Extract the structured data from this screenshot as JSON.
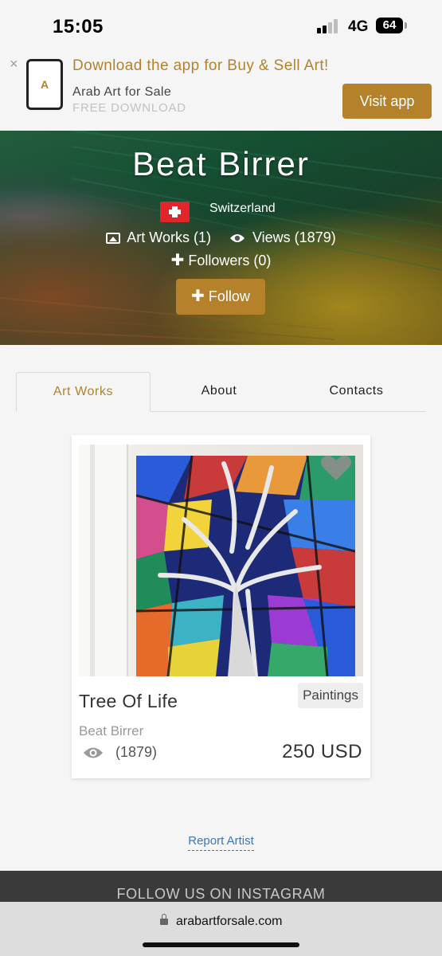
{
  "status_bar": {
    "time": "15:05",
    "network": "4G",
    "battery": "64"
  },
  "app_banner": {
    "close": "×",
    "title": "Download the app for Buy & Sell Art!",
    "app_name": "Arab Art for Sale",
    "free_text": "FREE DOWNLOAD",
    "visit_button": "Visit app",
    "thumb_logo": "A"
  },
  "artist": {
    "name": "Beat Birrer",
    "country": "Switzerland",
    "art_works": "Art Works (1)",
    "views": "Views (1879)",
    "followers": "Followers (0)",
    "follow_button": "Follow"
  },
  "tabs": [
    {
      "label": "Art Works",
      "active": true
    },
    {
      "label": "About",
      "active": false
    },
    {
      "label": "Contacts",
      "active": false
    }
  ],
  "artwork": {
    "title": "Tree Of Life",
    "category": "Paintings",
    "artist": "Beat Birrer",
    "views": "(1879)",
    "price": "250 USD"
  },
  "report_link": "Report Artist",
  "footer": {
    "title": "FOLLOW US ON INSTAGRAM"
  },
  "browser": {
    "url": "arabartforsale.com"
  },
  "colors": {
    "accent": "#b5822b",
    "link": "#3b78b7",
    "footer_bg": "#3a3a3a"
  },
  "icons": [
    "close-icon",
    "image-icon",
    "eye-icon",
    "plus-icon",
    "heart-icon",
    "lock-icon",
    "switzerland-flag-icon"
  ]
}
